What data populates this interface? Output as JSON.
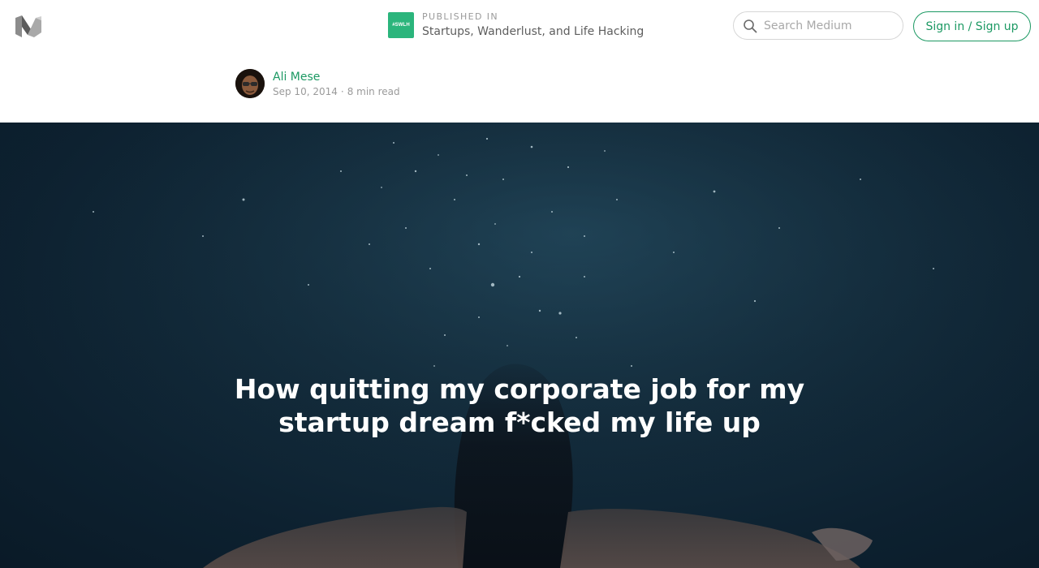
{
  "header": {
    "logo_icon": "medium-logo-icon",
    "publication": {
      "logo_text": "#SWLH",
      "logo_color": "#2bb57c",
      "label": "PUBLISHED IN",
      "name": "Startups, Wanderlust, and Life Hacking"
    },
    "search": {
      "icon": "search-icon",
      "placeholder": "Search Medium",
      "value": ""
    },
    "signin_label": "Sign in / Sign up",
    "accent_color": "#1c9963"
  },
  "author": {
    "name": "Ali Mese",
    "date": "Sep 10, 2014",
    "separator": "·",
    "read_time": "8 min read"
  },
  "hero": {
    "title": "How quitting my corporate job for my startup dream f*cked my life up"
  }
}
